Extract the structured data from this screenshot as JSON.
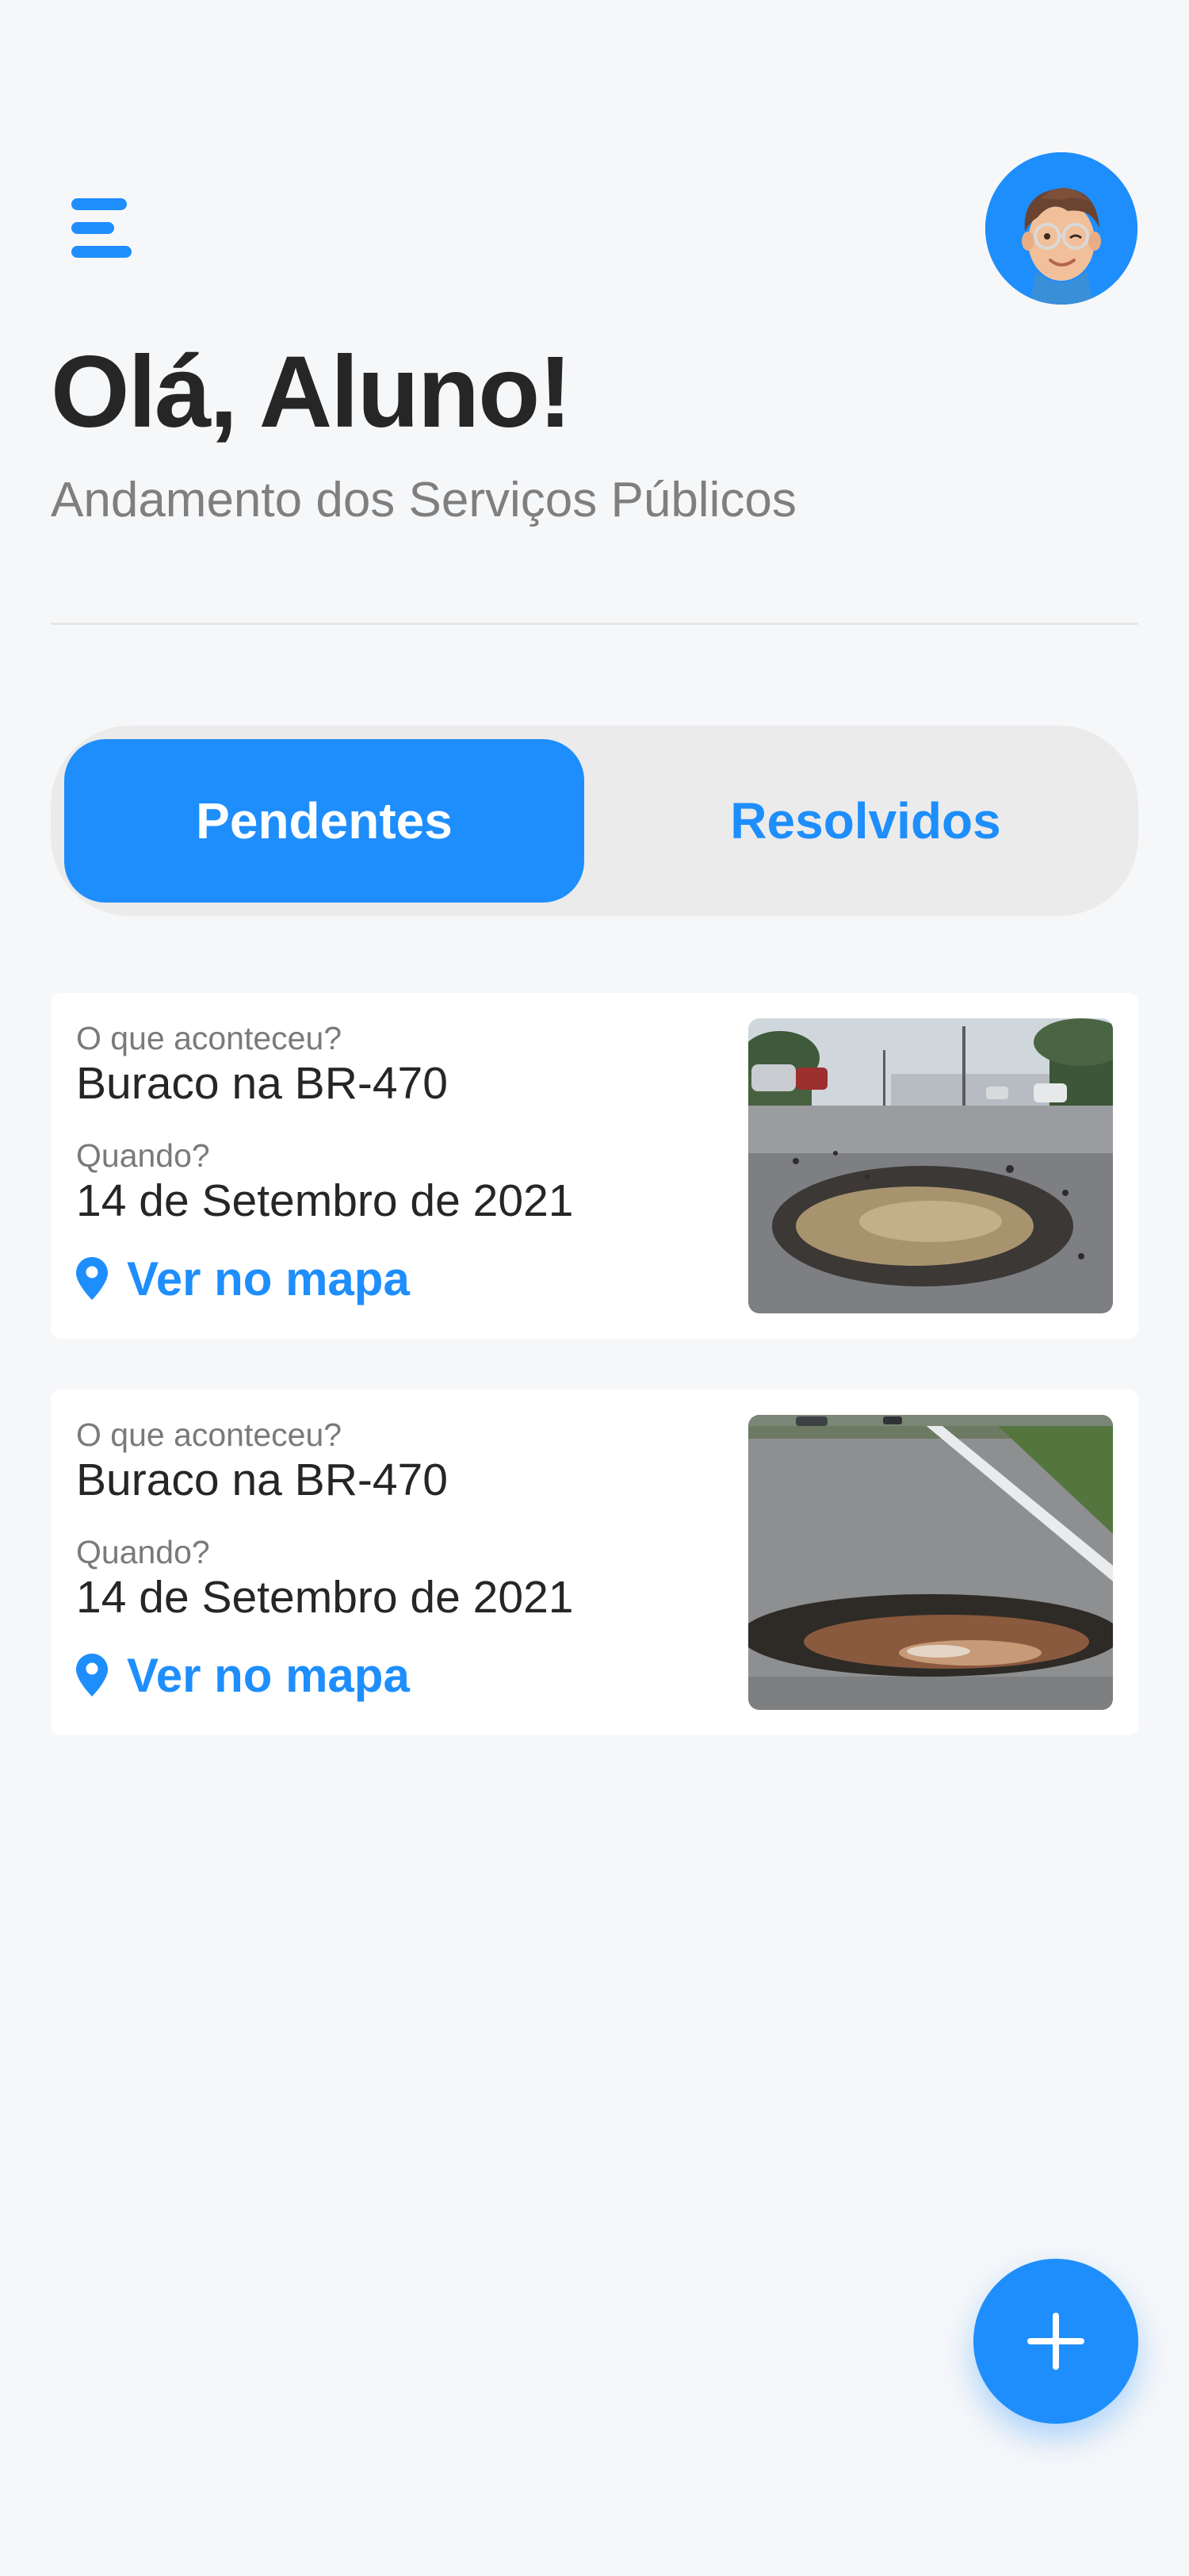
{
  "header": {
    "menu_icon": "hamburger-menu-icon",
    "avatar_icon": "memoji-avatar",
    "greeting": "Olá, Aluno!",
    "subtitle": "Andamento dos Serviços Públicos"
  },
  "tabs": [
    {
      "label": "Pendentes",
      "active": true
    },
    {
      "label": "Resolvidos",
      "active": false
    }
  ],
  "reports": [
    {
      "what_label": "O que aconteceu?",
      "what_value": "Buraco na BR-470",
      "when_label": "Quando?",
      "when_value": "14 de Setembro de 2021",
      "map_link": "Ver no mapa",
      "map_icon": "location-pin-icon",
      "photo": "pothole-photo"
    },
    {
      "what_label": "O que aconteceu?",
      "what_value": "Buraco na BR-470",
      "when_label": "Quando?",
      "when_value": "14 de Setembro de 2021",
      "map_link": "Ver no mapa",
      "map_icon": "location-pin-icon",
      "photo": "pothole-photo"
    }
  ],
  "fab": {
    "icon": "plus-icon"
  },
  "colors": {
    "accent": "#1E8EFC",
    "background": "#F6F7F9",
    "text": "#262626",
    "muted": "#7F7F7F"
  }
}
